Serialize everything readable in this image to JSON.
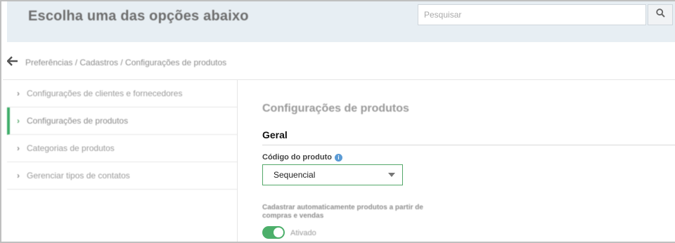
{
  "header": {
    "title": "Escolha uma das opções abaixo",
    "search_placeholder": "Pesquisar",
    "search_icon": "search-icon"
  },
  "breadcrumb": {
    "back_icon": "back-arrow-icon",
    "path": "Preferências / Cadastros / Configurações de produtos"
  },
  "sidebar": {
    "items": [
      {
        "label": "Configurações de clientes e fornecedores",
        "active": false
      },
      {
        "label": "Configurações de produtos",
        "active": true
      },
      {
        "label": "Categorias de produtos",
        "active": false
      },
      {
        "label": "Gerenciar tipos de contatos",
        "active": false
      }
    ]
  },
  "main": {
    "title": "Configurações de produtos",
    "section_title": "Geral",
    "product_code": {
      "label": "Código do produto",
      "info_icon": "info-icon",
      "selected_value": "Sequencial"
    },
    "auto_register": {
      "label": "Cadastrar automaticamente produtos a partir de compras e vendas",
      "toggle_state": "Ativado"
    }
  },
  "colors": {
    "accent": "#3fae6a",
    "header_bg": "#e7eef3",
    "info": "#5b9bd5"
  }
}
